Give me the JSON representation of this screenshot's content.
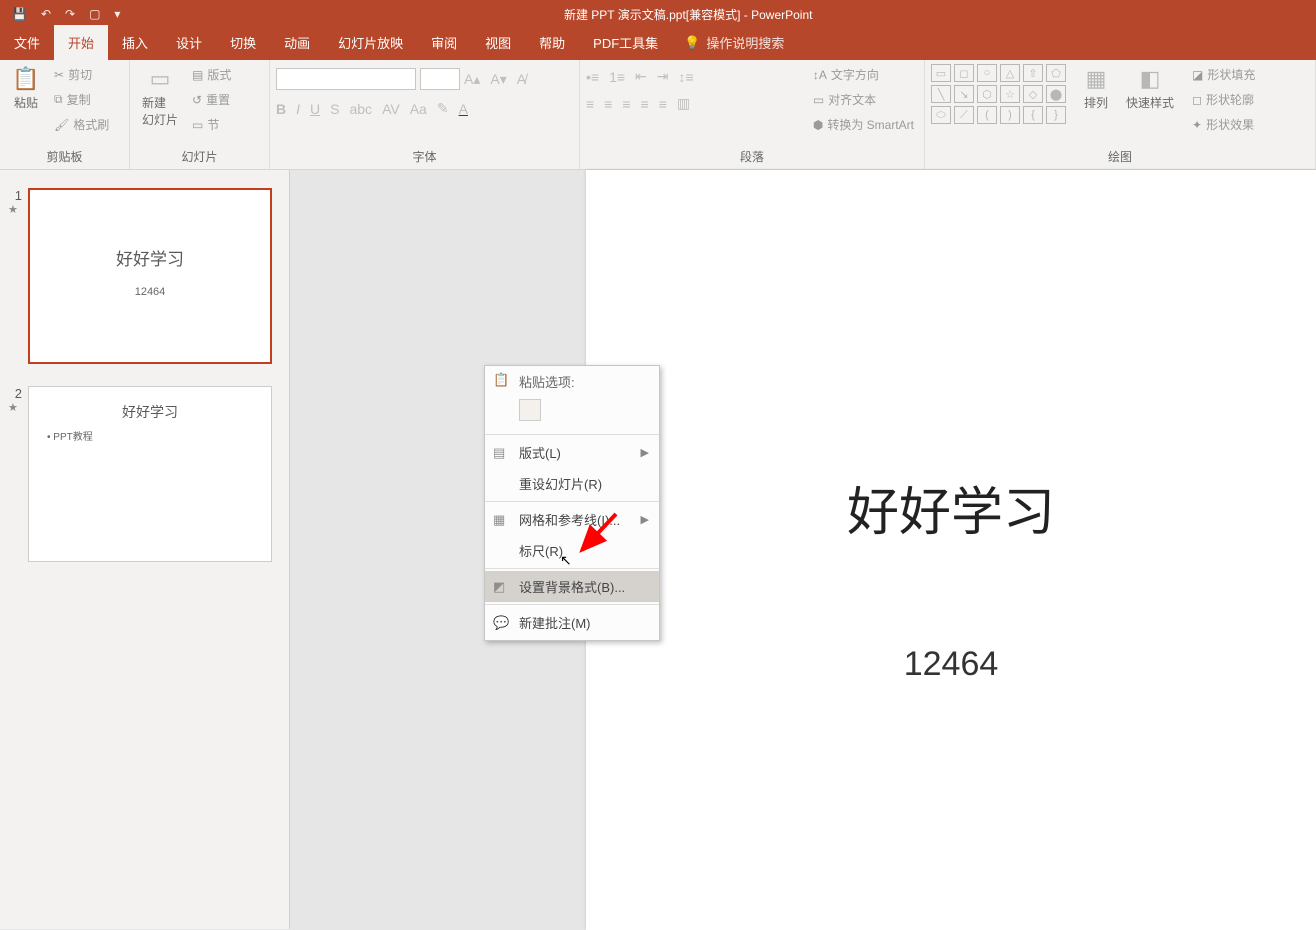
{
  "titlebar": {
    "title": "新建 PPT 演示文稿.ppt[兼容模式] - PowerPoint"
  },
  "tabs": {
    "file": "文件",
    "home": "开始",
    "insert": "插入",
    "design": "设计",
    "transitions": "切换",
    "animations": "动画",
    "slideshow": "幻灯片放映",
    "review": "审阅",
    "view": "视图",
    "help": "帮助",
    "pdf": "PDF工具集",
    "tell": "操作说明搜索"
  },
  "ribbon": {
    "clipboard": {
      "label": "剪贴板",
      "paste": "粘贴",
      "cut": "剪切",
      "copy": "复制",
      "painter": "格式刷"
    },
    "slides": {
      "label": "幻灯片",
      "new": "新建\n幻灯片",
      "layout": "版式",
      "reset": "重置",
      "section": "节"
    },
    "font": {
      "label": "字体"
    },
    "paragraph": {
      "label": "段落",
      "textdir": "文字方向",
      "align": "对齐文本",
      "smartart": "转换为 SmartArt"
    },
    "drawing": {
      "label": "绘图",
      "arrange": "排列",
      "quickstyle": "快速样式",
      "fill": "形状填充",
      "outline": "形状轮廓",
      "effects": "形状效果"
    }
  },
  "thumbnails": {
    "slide1": {
      "num": "1",
      "title": "好好学习",
      "sub": "12464"
    },
    "slide2": {
      "num": "2",
      "title": "好好学习",
      "bullet": "• PPT教程"
    }
  },
  "slide": {
    "title": "好好学习",
    "sub": "12464"
  },
  "context": {
    "paste_label": "粘贴选项:",
    "layout": "版式(L)",
    "reset": "重设幻灯片(R)",
    "grid": "网格和参考线(I)...",
    "ruler": "标尺(R)",
    "background": "设置背景格式(B)...",
    "comment": "新建批注(M)"
  }
}
